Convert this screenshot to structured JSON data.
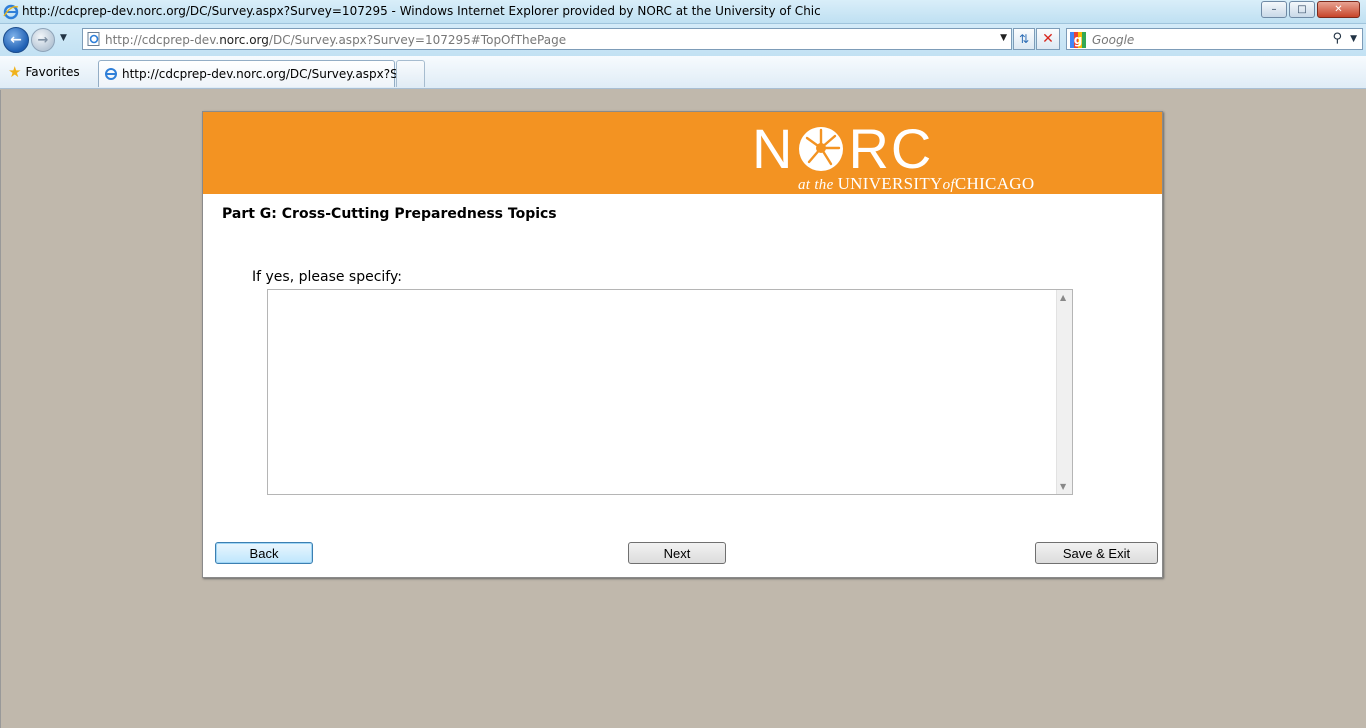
{
  "window": {
    "title": "http://cdcprep-dev.norc.org/DC/Survey.aspx?Survey=107295 - Windows Internet Explorer provided by NORC at the University of Chic",
    "controls": {
      "minimize": "–",
      "maximize": "□",
      "close": "✕"
    }
  },
  "address_bar": {
    "url_prefix": "http://cdcprep-dev.",
    "url_domain": "norc.org",
    "url_suffix": "/DC/Survey.aspx?Survey=107295#TopOfThePage"
  },
  "search": {
    "placeholder": "Google"
  },
  "favorites": {
    "label": "Favorites"
  },
  "tabs": [
    {
      "label": "http://cdcprep-dev.norc.org/DC/Survey.aspx?Sur..."
    }
  ],
  "logo": {
    "brand_n": "N",
    "brand_rc": "RC",
    "tag_at_the": "at the ",
    "tag_university": "UNIVERSITY",
    "tag_of": "of",
    "tag_chicago": "CHICAGO"
  },
  "survey": {
    "section_title": "Part G: Cross-Cutting Preparedness Topics",
    "question_label": "If yes, please specify:",
    "answer_value": ""
  },
  "buttons": {
    "back": "Back",
    "next": "Next",
    "save_exit": "Save & Exit"
  },
  "colors": {
    "banner": "#f39322",
    "page_background": "#c0b8ac"
  }
}
